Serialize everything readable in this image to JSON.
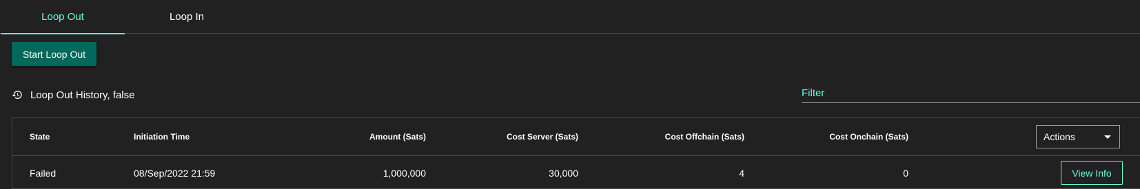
{
  "tabs": [
    {
      "label": "Loop Out",
      "active": true
    },
    {
      "label": "Loop In",
      "active": false
    }
  ],
  "start_button_label": "Start Loop Out",
  "history": {
    "icon": "history-icon",
    "title": "Loop Out History, false"
  },
  "filter": {
    "placeholder": "Filter",
    "value": ""
  },
  "table": {
    "columns": [
      "State",
      "Initiation Time",
      "Amount (Sats)",
      "Cost Server (Sats)",
      "Cost Offchain (Sats)",
      "Cost Onchain (Sats)"
    ],
    "actions_label": "Actions",
    "rows": [
      {
        "state": "Failed",
        "initiation_time": "08/Sep/2022 21:59",
        "amount": "1,000,000",
        "cost_server": "30,000",
        "cost_offchain": "4",
        "cost_onchain": "0",
        "action_label": "View Info"
      }
    ]
  },
  "colors": {
    "background": "#212121",
    "accent": "#64ffda",
    "primary_button": "#00695c",
    "border": "#4a4a4a"
  }
}
